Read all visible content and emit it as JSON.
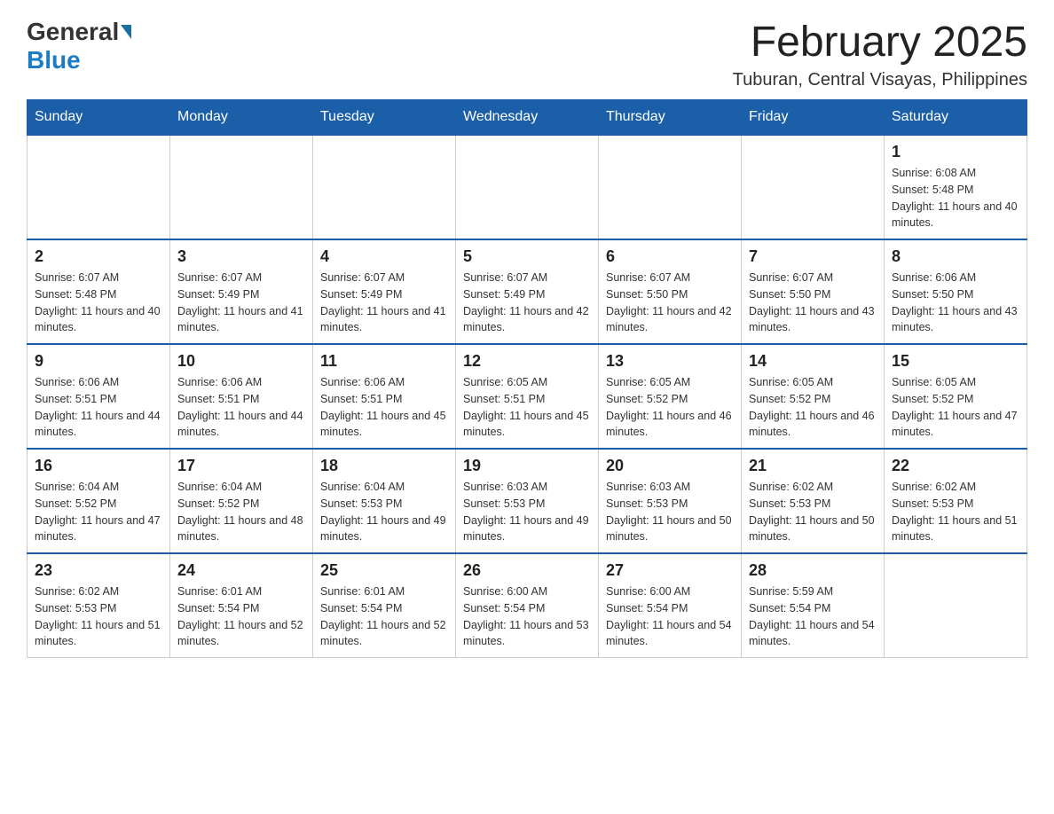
{
  "header": {
    "logo": {
      "general": "General",
      "blue": "Blue"
    },
    "title": "February 2025",
    "subtitle": "Tuburan, Central Visayas, Philippines"
  },
  "weekdays": [
    "Sunday",
    "Monday",
    "Tuesday",
    "Wednesday",
    "Thursday",
    "Friday",
    "Saturday"
  ],
  "weeks": [
    [
      {
        "day": "",
        "sunrise": "",
        "sunset": "",
        "daylight": ""
      },
      {
        "day": "",
        "sunrise": "",
        "sunset": "",
        "daylight": ""
      },
      {
        "day": "",
        "sunrise": "",
        "sunset": "",
        "daylight": ""
      },
      {
        "day": "",
        "sunrise": "",
        "sunset": "",
        "daylight": ""
      },
      {
        "day": "",
        "sunrise": "",
        "sunset": "",
        "daylight": ""
      },
      {
        "day": "",
        "sunrise": "",
        "sunset": "",
        "daylight": ""
      },
      {
        "day": "1",
        "sunrise": "Sunrise: 6:08 AM",
        "sunset": "Sunset: 5:48 PM",
        "daylight": "Daylight: 11 hours and 40 minutes."
      }
    ],
    [
      {
        "day": "2",
        "sunrise": "Sunrise: 6:07 AM",
        "sunset": "Sunset: 5:48 PM",
        "daylight": "Daylight: 11 hours and 40 minutes."
      },
      {
        "day": "3",
        "sunrise": "Sunrise: 6:07 AM",
        "sunset": "Sunset: 5:49 PM",
        "daylight": "Daylight: 11 hours and 41 minutes."
      },
      {
        "day": "4",
        "sunrise": "Sunrise: 6:07 AM",
        "sunset": "Sunset: 5:49 PM",
        "daylight": "Daylight: 11 hours and 41 minutes."
      },
      {
        "day": "5",
        "sunrise": "Sunrise: 6:07 AM",
        "sunset": "Sunset: 5:49 PM",
        "daylight": "Daylight: 11 hours and 42 minutes."
      },
      {
        "day": "6",
        "sunrise": "Sunrise: 6:07 AM",
        "sunset": "Sunset: 5:50 PM",
        "daylight": "Daylight: 11 hours and 42 minutes."
      },
      {
        "day": "7",
        "sunrise": "Sunrise: 6:07 AM",
        "sunset": "Sunset: 5:50 PM",
        "daylight": "Daylight: 11 hours and 43 minutes."
      },
      {
        "day": "8",
        "sunrise": "Sunrise: 6:06 AM",
        "sunset": "Sunset: 5:50 PM",
        "daylight": "Daylight: 11 hours and 43 minutes."
      }
    ],
    [
      {
        "day": "9",
        "sunrise": "Sunrise: 6:06 AM",
        "sunset": "Sunset: 5:51 PM",
        "daylight": "Daylight: 11 hours and 44 minutes."
      },
      {
        "day": "10",
        "sunrise": "Sunrise: 6:06 AM",
        "sunset": "Sunset: 5:51 PM",
        "daylight": "Daylight: 11 hours and 44 minutes."
      },
      {
        "day": "11",
        "sunrise": "Sunrise: 6:06 AM",
        "sunset": "Sunset: 5:51 PM",
        "daylight": "Daylight: 11 hours and 45 minutes."
      },
      {
        "day": "12",
        "sunrise": "Sunrise: 6:05 AM",
        "sunset": "Sunset: 5:51 PM",
        "daylight": "Daylight: 11 hours and 45 minutes."
      },
      {
        "day": "13",
        "sunrise": "Sunrise: 6:05 AM",
        "sunset": "Sunset: 5:52 PM",
        "daylight": "Daylight: 11 hours and 46 minutes."
      },
      {
        "day": "14",
        "sunrise": "Sunrise: 6:05 AM",
        "sunset": "Sunset: 5:52 PM",
        "daylight": "Daylight: 11 hours and 46 minutes."
      },
      {
        "day": "15",
        "sunrise": "Sunrise: 6:05 AM",
        "sunset": "Sunset: 5:52 PM",
        "daylight": "Daylight: 11 hours and 47 minutes."
      }
    ],
    [
      {
        "day": "16",
        "sunrise": "Sunrise: 6:04 AM",
        "sunset": "Sunset: 5:52 PM",
        "daylight": "Daylight: 11 hours and 47 minutes."
      },
      {
        "day": "17",
        "sunrise": "Sunrise: 6:04 AM",
        "sunset": "Sunset: 5:52 PM",
        "daylight": "Daylight: 11 hours and 48 minutes."
      },
      {
        "day": "18",
        "sunrise": "Sunrise: 6:04 AM",
        "sunset": "Sunset: 5:53 PM",
        "daylight": "Daylight: 11 hours and 49 minutes."
      },
      {
        "day": "19",
        "sunrise": "Sunrise: 6:03 AM",
        "sunset": "Sunset: 5:53 PM",
        "daylight": "Daylight: 11 hours and 49 minutes."
      },
      {
        "day": "20",
        "sunrise": "Sunrise: 6:03 AM",
        "sunset": "Sunset: 5:53 PM",
        "daylight": "Daylight: 11 hours and 50 minutes."
      },
      {
        "day": "21",
        "sunrise": "Sunrise: 6:02 AM",
        "sunset": "Sunset: 5:53 PM",
        "daylight": "Daylight: 11 hours and 50 minutes."
      },
      {
        "day": "22",
        "sunrise": "Sunrise: 6:02 AM",
        "sunset": "Sunset: 5:53 PM",
        "daylight": "Daylight: 11 hours and 51 minutes."
      }
    ],
    [
      {
        "day": "23",
        "sunrise": "Sunrise: 6:02 AM",
        "sunset": "Sunset: 5:53 PM",
        "daylight": "Daylight: 11 hours and 51 minutes."
      },
      {
        "day": "24",
        "sunrise": "Sunrise: 6:01 AM",
        "sunset": "Sunset: 5:54 PM",
        "daylight": "Daylight: 11 hours and 52 minutes."
      },
      {
        "day": "25",
        "sunrise": "Sunrise: 6:01 AM",
        "sunset": "Sunset: 5:54 PM",
        "daylight": "Daylight: 11 hours and 52 minutes."
      },
      {
        "day": "26",
        "sunrise": "Sunrise: 6:00 AM",
        "sunset": "Sunset: 5:54 PM",
        "daylight": "Daylight: 11 hours and 53 minutes."
      },
      {
        "day": "27",
        "sunrise": "Sunrise: 6:00 AM",
        "sunset": "Sunset: 5:54 PM",
        "daylight": "Daylight: 11 hours and 54 minutes."
      },
      {
        "day": "28",
        "sunrise": "Sunrise: 5:59 AM",
        "sunset": "Sunset: 5:54 PM",
        "daylight": "Daylight: 11 hours and 54 minutes."
      },
      {
        "day": "",
        "sunrise": "",
        "sunset": "",
        "daylight": ""
      }
    ]
  ]
}
